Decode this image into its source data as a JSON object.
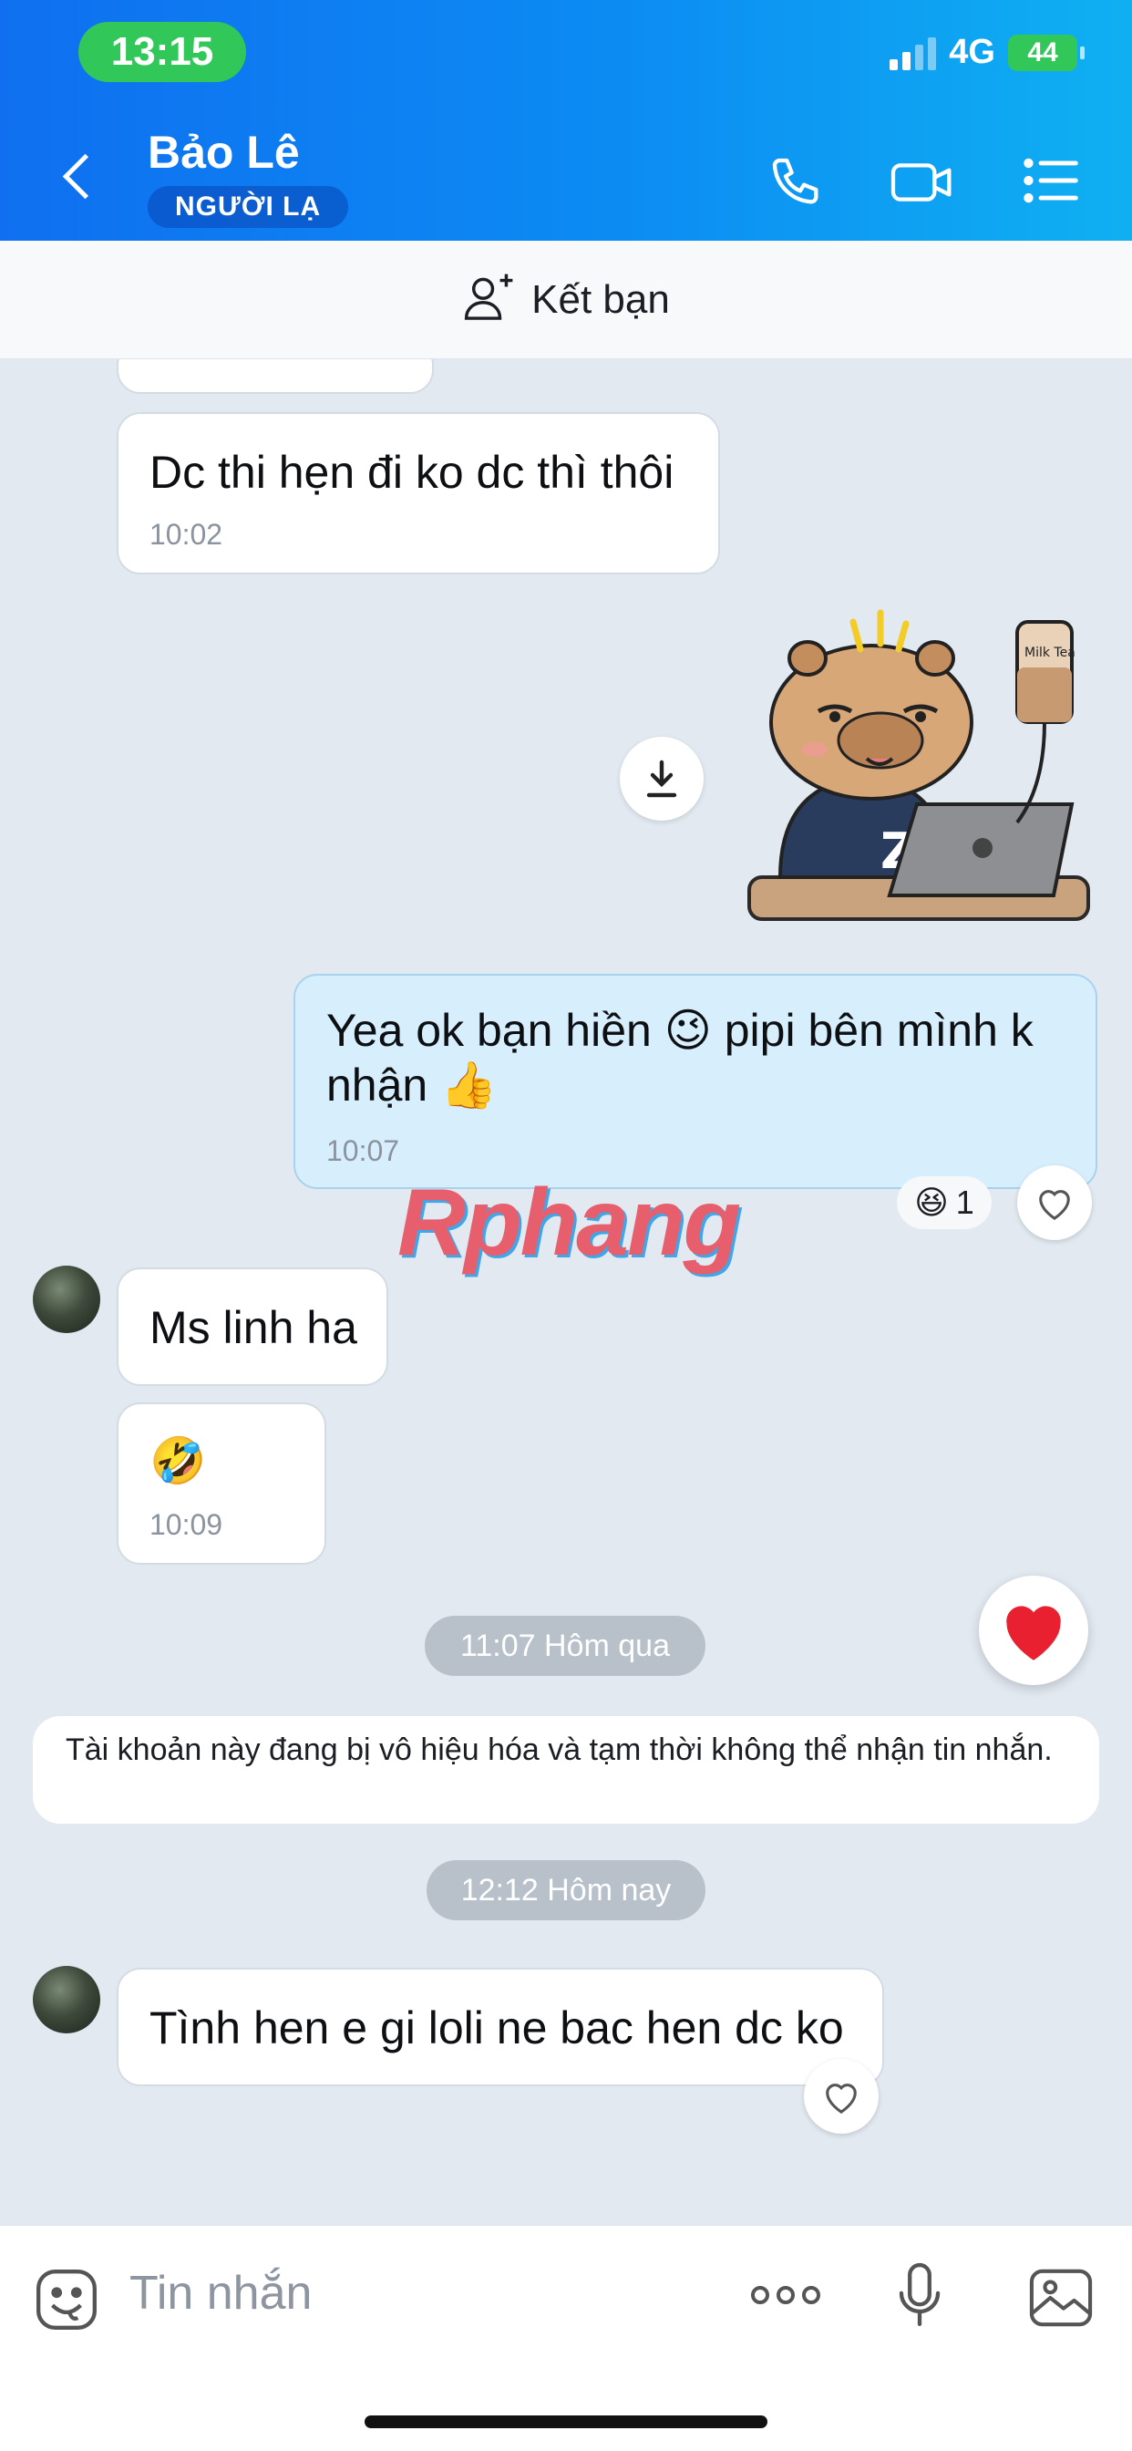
{
  "status_bar": {
    "time": "13:15",
    "network": "4G",
    "battery": "44"
  },
  "header": {
    "contact_name": "Bảo Lê",
    "badge": "NGƯỜI LẠ",
    "icons": [
      "back-arrow-icon",
      "phone-icon",
      "video-call-icon",
      "list-menu-icon"
    ]
  },
  "add_friend": {
    "label": "Kết bạn",
    "icon": "add-user-icon"
  },
  "messages": [
    {
      "direction": "in",
      "text": "Dc thi hẹn đi ko dc thì thôi",
      "time": "10:02"
    },
    {
      "direction": "out",
      "type": "sticker",
      "description_icon": "capybara-milk-tea-sticker"
    },
    {
      "direction": "out",
      "text": "Yea ok bạn hiền 😉 pipi bên mình k nhận 👍",
      "time": "10:07",
      "reaction": {
        "emoji": "😆",
        "count": "1"
      }
    },
    {
      "direction": "in",
      "text": "Ms linh ha"
    },
    {
      "direction": "in",
      "text": "🤣",
      "time": "10:09"
    },
    {
      "direction": "in",
      "text": "Tình hen e gi loli ne bac hen dc ko"
    }
  ],
  "watermark": "Rphang",
  "dividers": {
    "yesterday": "11:07 Hôm qua",
    "today": "12:12 Hôm nay"
  },
  "system_notice": "Tài khoản này đang bị vô hiệu hóa và tạm thời không thể nhận tin nhắn.",
  "composer": {
    "placeholder": "Tin nhắn",
    "icons": [
      "sticker-icon",
      "more-icon",
      "microphone-icon",
      "image-icon"
    ]
  },
  "colors": {
    "header_blue": "#0c8cf3",
    "outgoing_bubble": "#d7effd",
    "chat_bg": "#e2e9f1",
    "heart_red": "#e8202f"
  }
}
